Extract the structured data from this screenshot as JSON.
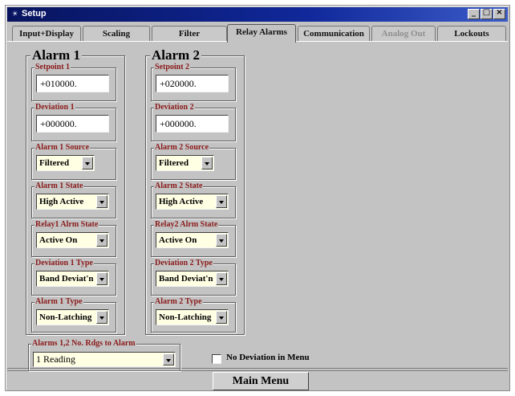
{
  "window": {
    "title": "Setup"
  },
  "tabs": [
    {
      "label": "Input+Display"
    },
    {
      "label": "Scaling"
    },
    {
      "label": "Filter"
    },
    {
      "label": "Relay Alarms",
      "active": true
    },
    {
      "label": "Communication"
    },
    {
      "label": "Analog Out",
      "disabled": true
    },
    {
      "label": "Lockouts"
    }
  ],
  "alarm1": {
    "title": "Alarm 1",
    "setpoint": {
      "label": "Setpoint 1",
      "value": "+010000."
    },
    "deviation": {
      "label": "Deviation 1",
      "value": "+000000."
    },
    "source": {
      "label": "Alarm 1 Source",
      "value": "Filtered"
    },
    "state": {
      "label": "Alarm 1 State",
      "value": "High Active"
    },
    "relay_state": {
      "label": "Relay1 Alrm State",
      "value": "Active On"
    },
    "deviation_type": {
      "label": "Deviation 1 Type",
      "value": "Band Deviat'n"
    },
    "type": {
      "label": "Alarm 1 Type",
      "value": "Non-Latching"
    }
  },
  "alarm2": {
    "title": "Alarm 2",
    "setpoint": {
      "label": "Setpoint 2",
      "value": "+020000."
    },
    "deviation": {
      "label": "Deviation 2",
      "value": "+000000."
    },
    "source": {
      "label": "Alarm 2 Source",
      "value": "Filtered"
    },
    "state": {
      "label": "Alarm 2 State",
      "value": "High Active"
    },
    "relay_state": {
      "label": "Relay2 Alrm State",
      "value": "Active On"
    },
    "deviation_type": {
      "label": "Deviation 2 Type",
      "value": "Band Deviat'n"
    },
    "type": {
      "label": "Alarm 2 Type",
      "value": "Non-Latching"
    }
  },
  "readings_to_alarm": {
    "label": "Alarms 1,2 No. Rdgs to Alarm",
    "value": "1 Reading"
  },
  "no_deviation_in_menu": {
    "label": "No Deviation in Menu",
    "checked": false
  },
  "main_menu_button": {
    "label": "Main Menu"
  },
  "colors": {
    "titlebar": "#10289a",
    "dialog_face": "#c3c3c3",
    "field_label": "#8b1a1a",
    "dropdown_bg": "#ffffe4"
  }
}
